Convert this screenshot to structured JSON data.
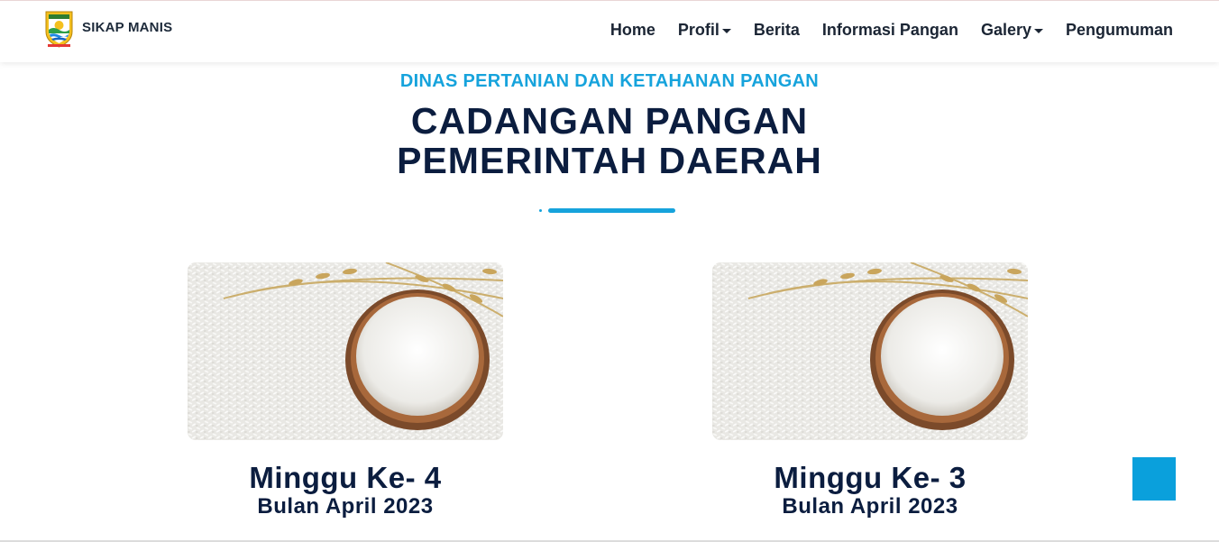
{
  "header": {
    "brand_name": "SIKAP MANIS",
    "nav": [
      {
        "label": "Home"
      },
      {
        "label": "Profil",
        "dropdown": true
      },
      {
        "label": "Berita"
      },
      {
        "label": "Informasi Pangan"
      },
      {
        "label": "Galery",
        "dropdown": true
      },
      {
        "label": "Pengumuman"
      }
    ]
  },
  "section": {
    "subtitle": "DINAS PERTANIAN DAN KETAHANAN PANGAN",
    "title_line1": "CADANGAN PANGAN",
    "title_line2": "PEMERINTAH DAERAH"
  },
  "cards": [
    {
      "title": "Minggu Ke- 4",
      "subtitle": "Bulan April 2023"
    },
    {
      "title": "Minggu Ke- 3",
      "subtitle": "Bulan April 2023"
    }
  ],
  "colors": {
    "accent": "#16a3dc",
    "heading": "#0b1d3f",
    "nav_text": "#1b2534",
    "back_to_top": "#0aa0dc"
  },
  "icons": {
    "logo": "regency-emblem-icon",
    "dropdown": "caret-down-icon",
    "back_to_top": "back-to-top-icon"
  }
}
